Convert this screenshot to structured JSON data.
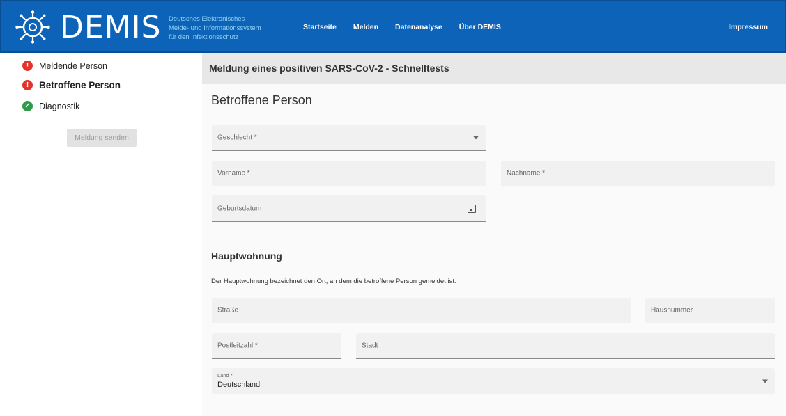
{
  "header": {
    "logo_text": "DEMIS",
    "subtitle_lines": [
      "Deutsches Elektronisches",
      "Melde- und Informationssystem",
      "für den Infektionsschutz"
    ],
    "nav": [
      "Startseite",
      "Melden",
      "Datenanalyse",
      "Über DEMIS"
    ],
    "impressum": "Impressum"
  },
  "sidebar": {
    "items": [
      {
        "label": "Meldende Person",
        "status": "error"
      },
      {
        "label": "Betroffene Person",
        "status": "error"
      },
      {
        "label": "Diagnostik",
        "status": "ok"
      }
    ],
    "send_button": "Meldung senden"
  },
  "main": {
    "bar_title": "Meldung eines positiven SARS-CoV-2 - Schnelltests",
    "section_title": "Betroffene Person",
    "fields": {
      "geschlecht": "Geschlecht *",
      "vorname": "Vorname *",
      "nachname": "Nachname *",
      "geburtsdatum": "Geburtsdatum"
    },
    "hauptwohnung": {
      "title": "Hauptwohnung",
      "description": "Der Hauptwohnung bezeichnet den Ort, an dem die betroffene Person gemeldet ist.",
      "strasse": "Straße",
      "hausnummer": "Hausnummer",
      "postleitzahl": "Postleitzahl *",
      "stadt": "Stadt",
      "land_label": "Land *",
      "land_value": "Deutschland"
    }
  },
  "colors": {
    "header_bg": "#0d63b8",
    "subtitle_text": "#8fd0f5",
    "error": "#e6332a",
    "ok": "#2e9b4a"
  }
}
